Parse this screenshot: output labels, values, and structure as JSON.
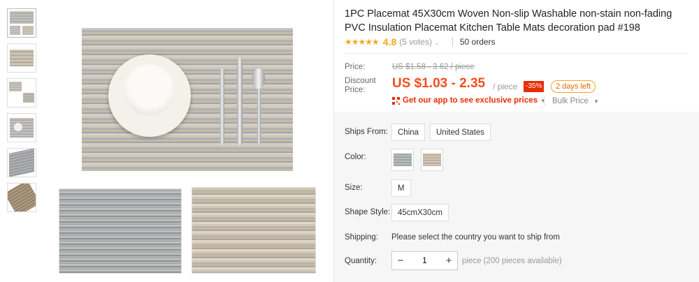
{
  "title": "1PC Placemat 45X30cm Woven Non-slip Washable non-stain non-fading PVC Insulation Placemat Kitchen Table Mats decoration pad #198",
  "rating": {
    "stars": "★★★★★",
    "score": "4.8",
    "votes": "(5 votes)",
    "orders": "50 orders"
  },
  "price": {
    "price_label": "Price:",
    "original": "US $1.58 - 3.62 / piece",
    "discount_label_1": "Discount",
    "discount_label_2": "Price:",
    "current": "US $1.03 - 2.35",
    "unit": "/ piece",
    "discount_badge": "-35%",
    "days_left": "2 days left",
    "app_promo": "Get our app to see exclusive prices",
    "bulk": "Bulk Price"
  },
  "options": {
    "ships_from_label": "Ships From:",
    "ships_from": [
      "China",
      "United States"
    ],
    "color_label": "Color:",
    "size_label": "Size:",
    "size": "M",
    "shape_label": "Shape Style:",
    "shape": "45cmX30cm",
    "shipping_label": "Shipping:",
    "shipping_msg": "Please select the country you want to ship from",
    "quantity_label": "Quantity:",
    "quantity": "1",
    "availability": "piece (200 pieces available)"
  },
  "colors": {
    "price": "#f44d1e",
    "badge": "#e62e04",
    "star": "#f5a623"
  }
}
